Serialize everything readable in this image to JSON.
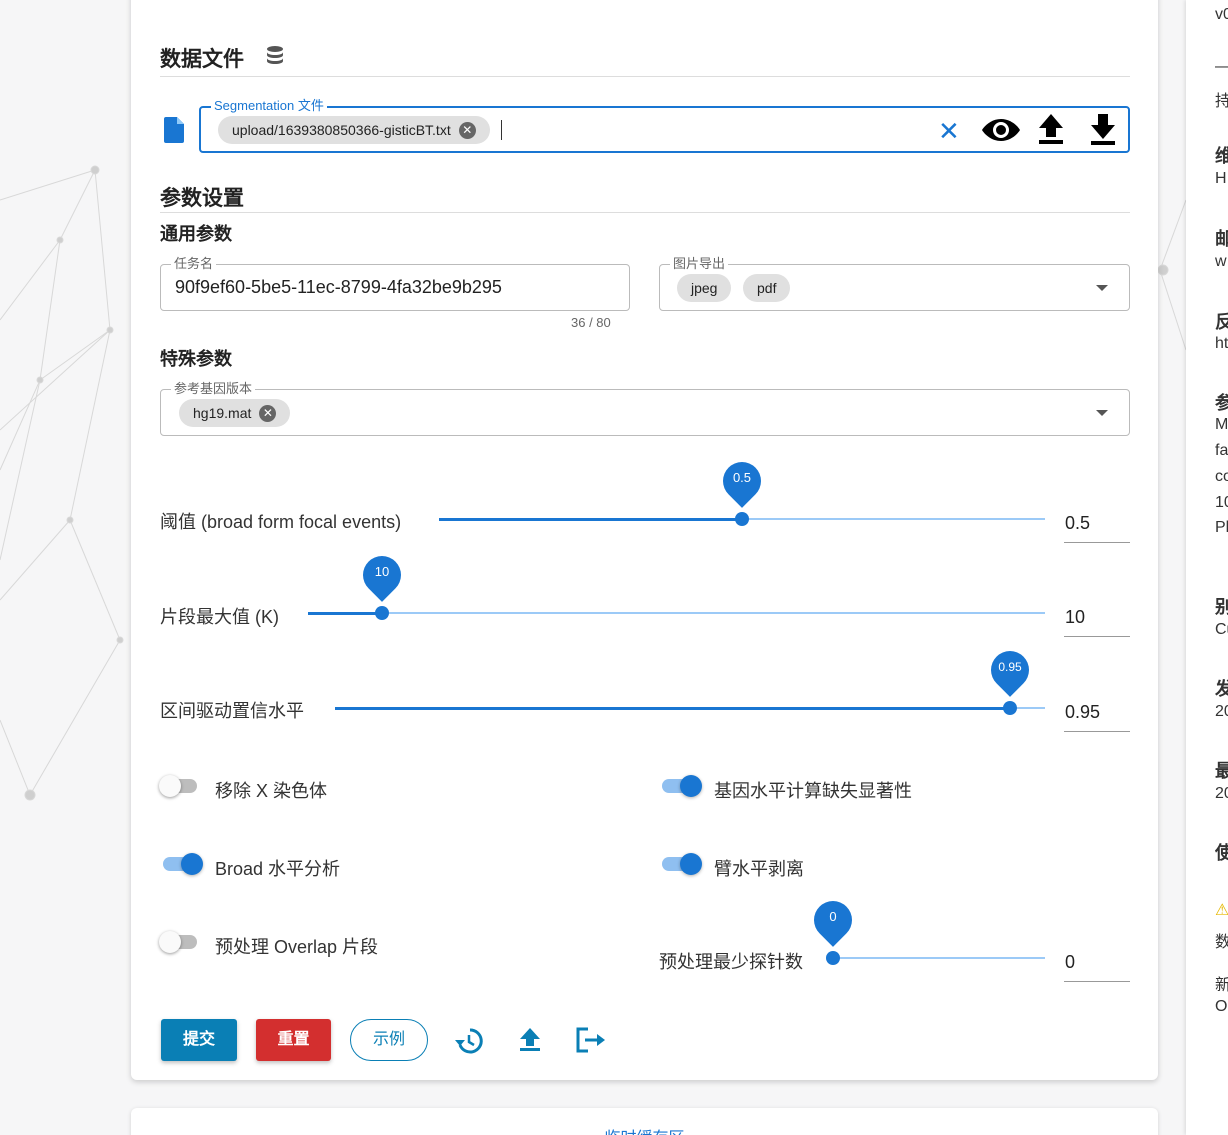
{
  "data_file": {
    "heading": "数据文件",
    "icon": "database-icon",
    "field_label": "Segmentation 文件",
    "chip_value": "upload/1639380850366-gisticBT.txt",
    "actions": [
      "clear-icon",
      "eye-icon",
      "upload-icon",
      "download-icon"
    ]
  },
  "params": {
    "heading": "参数设置",
    "general_heading": "通用参数",
    "task_name_label": "任务名",
    "task_name_value": "90f9ef60-5be5-11ec-8799-4fa32be9b295",
    "task_name_counter": "36 / 80",
    "image_export_label": "图片导出",
    "image_export_chips": [
      "jpeg",
      "pdf"
    ],
    "special_heading": "特殊参数",
    "ref_genome_label": "参考基因版本",
    "ref_genome_chip": "hg19.mat"
  },
  "sliders": [
    {
      "label": "阈值 (broad form focal events)",
      "value": "0.5",
      "fraction": 0.5
    },
    {
      "label": "片段最大值 (K)",
      "value": "10",
      "fraction": 0.1
    },
    {
      "label": "区间驱动置信水平",
      "value": "0.95",
      "fraction": 0.95
    }
  ],
  "switches": [
    {
      "label": "移除 X 染色体",
      "on": false
    },
    {
      "label": "基因水平计算缺失显著性",
      "on": true
    },
    {
      "label": "Broad 水平分析",
      "on": true
    },
    {
      "label": "臂水平剥离",
      "on": true
    },
    {
      "label": "预处理 Overlap 片段",
      "on": false
    }
  ],
  "probe_slider": {
    "label": "预处理最少探针数",
    "value": "0",
    "fraction": 0.0
  },
  "buttons": {
    "submit": "提交",
    "reset": "重置",
    "example": "示例"
  },
  "colors": {
    "primary": "#1976d2",
    "submit": "#0a7fb5",
    "reset": "#d32f2f"
  },
  "bottom_card_title": "临时缓存区",
  "right_panel": [
    "v0",
    "—",
    "持",
    "维",
    "H",
    "邮",
    "w",
    "反",
    "ht",
    "参",
    "M",
    "fa",
    "co",
    "10",
    "Pl",
    "别",
    "Cu",
    "发",
    "20",
    "最",
    "20",
    "使",
    "⚠",
    "数",
    "新",
    "O"
  ]
}
